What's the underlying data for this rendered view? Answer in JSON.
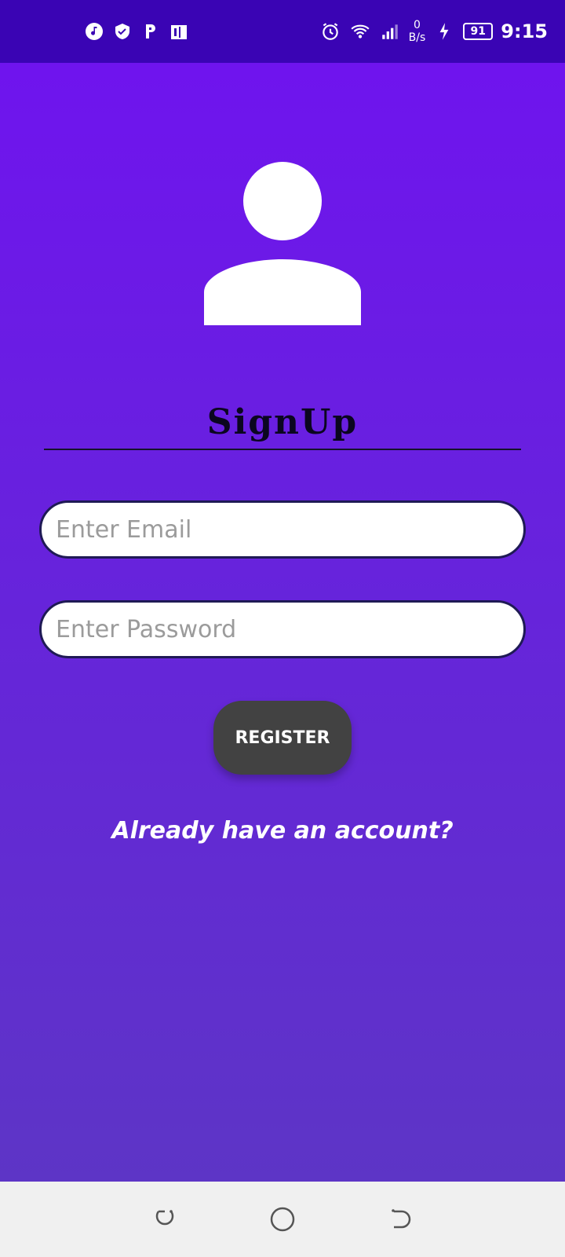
{
  "status_bar": {
    "left_icons": [
      "music-icon",
      "shield-check-icon",
      "p-icon",
      "book-icon"
    ],
    "data_speed_value": "0",
    "data_speed_unit": "B/s",
    "battery": "91",
    "time": "9:15"
  },
  "screen": {
    "title": "SignUp",
    "email_placeholder": "Enter Email",
    "password_placeholder": "Enter Password",
    "register_label": "REGISTER",
    "login_link": "Already have an account?"
  },
  "nav_bar": {
    "icons": [
      "recent-apps-icon",
      "home-icon",
      "back-icon"
    ]
  },
  "colors": {
    "status_bar": "#3a04b4",
    "gradient_top": "#6f14ee",
    "gradient_bottom": "#5d35c6",
    "button": "#424242",
    "nav_bar": "#f0f0f0"
  }
}
